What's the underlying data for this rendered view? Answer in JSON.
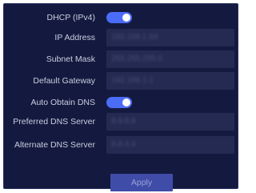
{
  "network_settings": {
    "dhcp": {
      "label": "DHCP (IPv4)",
      "enabled": true
    },
    "ip_address": {
      "label": "IP Address",
      "value": "192.168.1.64"
    },
    "subnet_mask": {
      "label": "Subnet Mask",
      "value": "255.255.255.0"
    },
    "default_gateway": {
      "label": "Default Gateway",
      "value": "192.168.1.1"
    },
    "auto_obtain_dns": {
      "label": "Auto Obtain DNS",
      "enabled": true
    },
    "preferred_dns": {
      "label": "Preferred DNS Server",
      "value": "8.8.8.8"
    },
    "alternate_dns": {
      "label": "Alternate DNS Server",
      "value": "8.8.4.4"
    },
    "apply_label": "Apply"
  },
  "colors": {
    "panel_bg": "#141a3f",
    "field_bg": "#242a52",
    "toggle_on": "#4a6cf7",
    "button_bg": "#3f4ca8"
  }
}
